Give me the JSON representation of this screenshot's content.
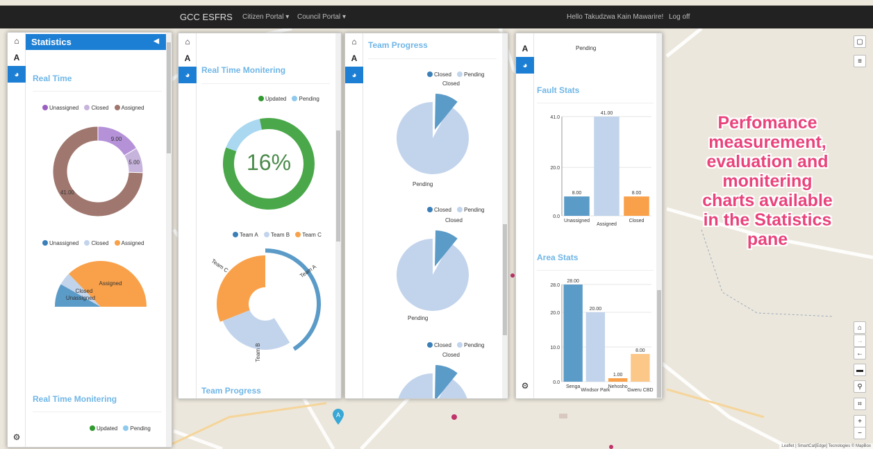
{
  "header": {
    "brand": "GCC ESFRS",
    "citizen_portal": "Citizen Portal ▾",
    "council_portal": "Council Portal ▾",
    "greeting": "Hello Takudzwa Kain Mawarire!",
    "logoff": "Log off"
  },
  "callout": {
    "lines": [
      "Perfomance",
      "measurement,",
      "evaluation and",
      "monitering",
      "charts available",
      "in the Statistics",
      "pane"
    ]
  },
  "panel1": {
    "title": "Statistics",
    "section_realtime": "Real Time",
    "legend1": [
      "Unassigned",
      "Closed",
      "Assigned"
    ],
    "donut_labels": [
      "9.00",
      "5.00",
      "41.00"
    ],
    "legend2": [
      "Unassigned",
      "Closed",
      "Assigned"
    ],
    "half_labels": [
      "Assigned",
      "Closed",
      "Unassigned"
    ],
    "section_rtm": "Real Time Monitering",
    "legend3": [
      "Updated",
      "Pending"
    ]
  },
  "panel2": {
    "section_rtm": "Real Time Monitering",
    "legend_gauge": [
      "Updated",
      "Pending"
    ],
    "gauge_value": "16%",
    "legend_team": [
      "Team A",
      "Team B",
      "Team C"
    ],
    "team_labels": [
      "Team C",
      "Team A",
      "Team B"
    ],
    "section_tp": "Team Progress"
  },
  "panel3": {
    "section_tp": "Team Progress",
    "legend": [
      "Closed",
      "Pending"
    ],
    "closed_label": "Closed",
    "pending_label": "Pending"
  },
  "panel4": {
    "pending_top": "Pending",
    "section_fault": "Fault Stats",
    "section_area": "Area Stats"
  },
  "colors": {
    "blue": "#1d7fd4",
    "assigned_brown": "#a0776f",
    "closed_lilac": "#c7b4dc",
    "unassigned_purple": "#b591d8",
    "steel": "#5b9bc8",
    "light": "#c2d4ec",
    "orange": "#f9a14a",
    "green": "#4aa84a",
    "pink": "#e9437c"
  },
  "chart_data": [
    {
      "type": "pie",
      "categories": [
        "Unassigned",
        "Closed",
        "Assigned"
      ],
      "values": [
        9,
        5,
        41
      ],
      "title": ""
    },
    {
      "type": "pie",
      "categories": [
        "Unassigned",
        "Closed",
        "Assigned"
      ],
      "values": [
        9,
        5,
        41
      ],
      "title": ""
    },
    {
      "type": "pie",
      "categories": [
        "Updated",
        "Pending"
      ],
      "values": [
        16,
        84
      ],
      "title": ""
    },
    {
      "type": "pie",
      "categories": [
        "Team A",
        "Team B",
        "Team C"
      ],
      "values": [
        41,
        28,
        31
      ],
      "title": ""
    },
    {
      "type": "pie",
      "categories": [
        "Closed",
        "Pending"
      ],
      "values": [
        8,
        92
      ],
      "title": ""
    },
    {
      "type": "bar",
      "title": "Fault Stats",
      "categories": [
        "Unassigned",
        "Assigned",
        "Closed"
      ],
      "values": [
        8,
        41,
        8
      ],
      "value_labels": [
        "8.00",
        "41.00",
        "8.00"
      ],
      "ylim": [
        0,
        41
      ],
      "yticks": [
        "0.0",
        "20.0",
        "41.0"
      ]
    },
    {
      "type": "bar",
      "title": "Area Stats",
      "categories": [
        "Senga",
        "Windsor Park",
        "Nehosho",
        "Gweru CBD"
      ],
      "values": [
        28,
        20,
        1,
        8
      ],
      "value_labels": [
        "28.00",
        "20.00",
        "1.00",
        "8.00"
      ],
      "ylim": [
        0,
        28
      ],
      "yticks": [
        "0.0",
        "10.0",
        "20.0",
        "28.0"
      ]
    }
  ],
  "map": {
    "attribution": "Leaflet | SmartCat[Edge] Tecnologies © MapBox",
    "marker_letter": "A"
  }
}
